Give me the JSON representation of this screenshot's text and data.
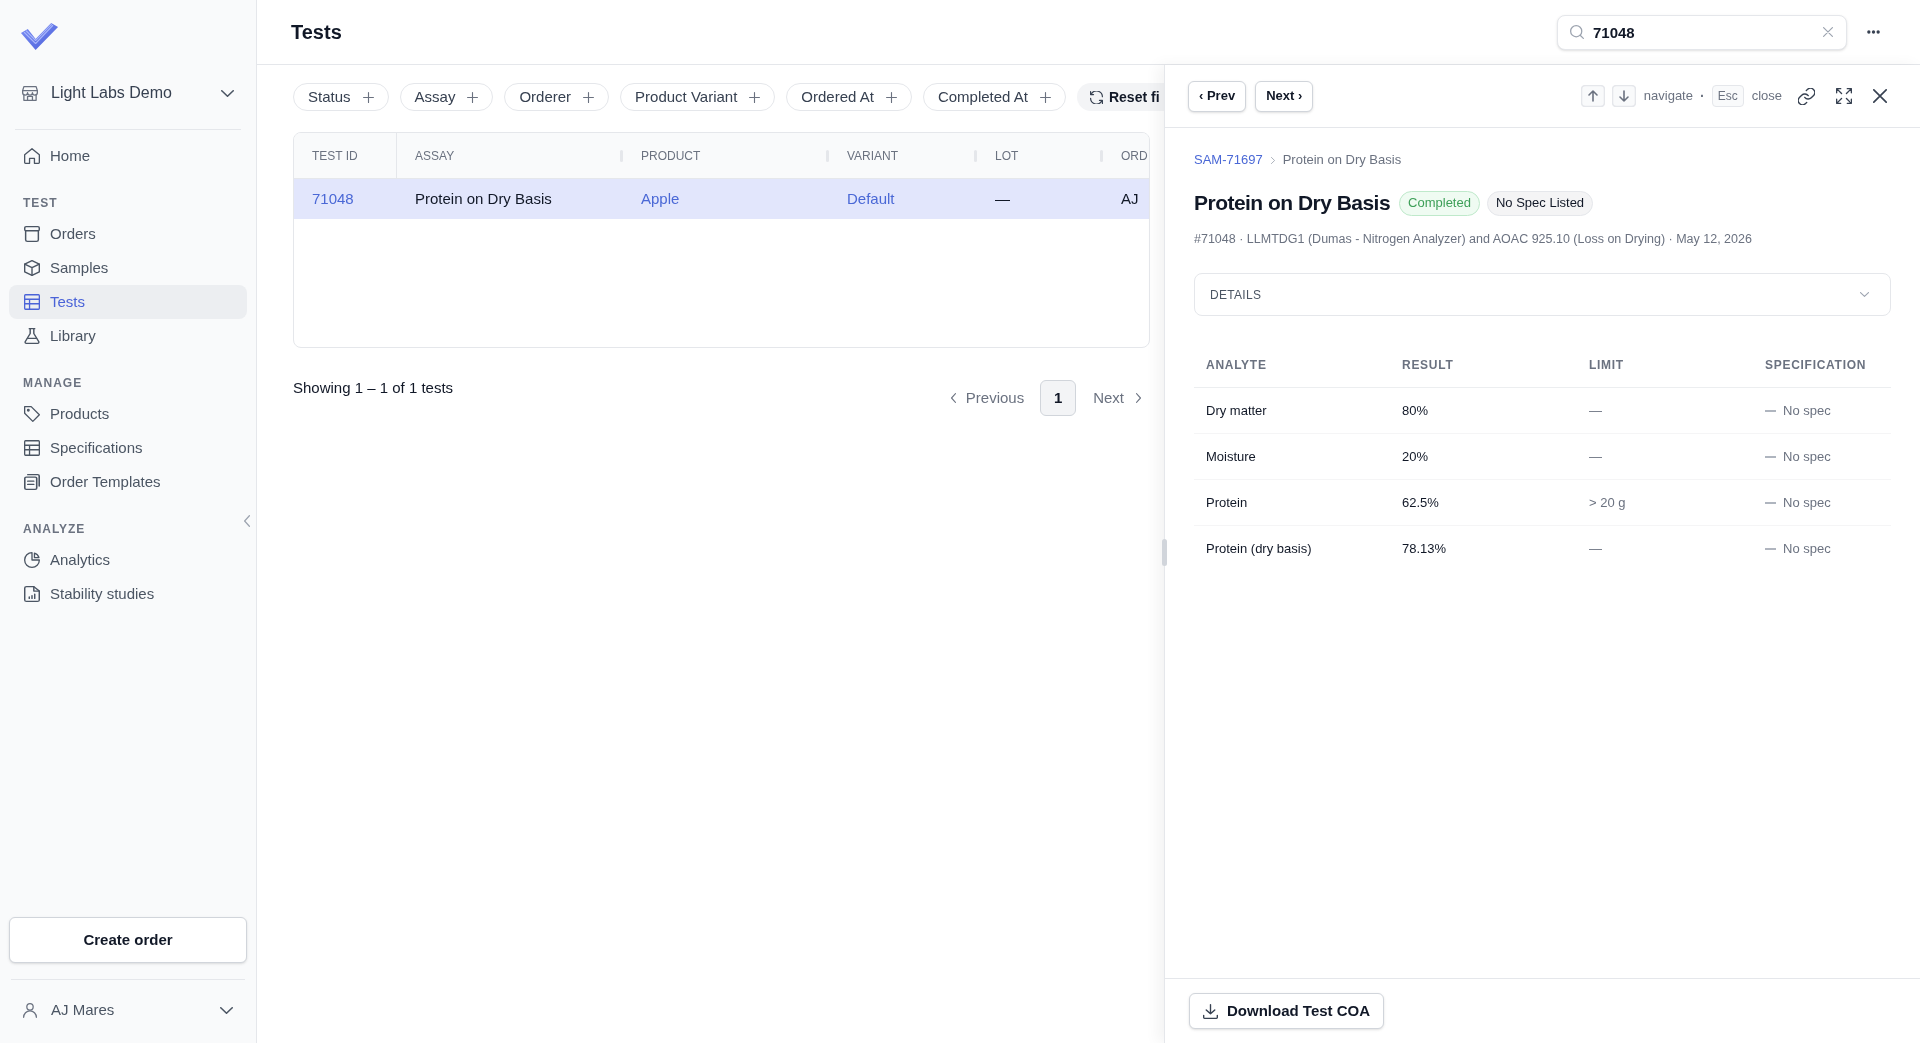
{
  "sidebar": {
    "org": {
      "name": "Light Labs Demo"
    },
    "sections": [
      {
        "items": [
          {
            "label": "Home",
            "selected": false
          }
        ]
      },
      {
        "heading": "TEST",
        "items": [
          {
            "label": "Orders",
            "selected": false
          },
          {
            "label": "Samples",
            "selected": false
          },
          {
            "label": "Tests",
            "selected": true
          },
          {
            "label": "Library",
            "selected": false
          }
        ]
      },
      {
        "heading": "MANAGE",
        "items": [
          {
            "label": "Products",
            "selected": false
          },
          {
            "label": "Specifications",
            "selected": false
          },
          {
            "label": "Order Templates",
            "selected": false
          }
        ]
      },
      {
        "heading": "ANALYZE",
        "items": [
          {
            "label": "Analytics",
            "selected": false
          },
          {
            "label": "Stability studies",
            "selected": false
          }
        ]
      }
    ],
    "create_button": "Create order",
    "user": {
      "name": "AJ Mares"
    }
  },
  "header": {
    "title": "Tests",
    "search": {
      "value": "71048"
    }
  },
  "filters": [
    {
      "label": "Status"
    },
    {
      "label": "Assay"
    },
    {
      "label": "Orderer"
    },
    {
      "label": "Product Variant"
    },
    {
      "label": "Ordered At"
    },
    {
      "label": "Completed At"
    }
  ],
  "reset_button": {
    "label": "Reset fi"
  },
  "table": {
    "columns": [
      "TEST ID",
      "ASSAY",
      "PRODUCT",
      "VARIANT",
      "LOT",
      "ORD"
    ],
    "rows": [
      {
        "selected": true,
        "cells": [
          {
            "text": "71048",
            "kind": "link"
          },
          {
            "text": "Protein on Dry Basis",
            "kind": "text"
          },
          {
            "text": "Apple",
            "kind": "link"
          },
          {
            "text": "Default",
            "kind": "link"
          },
          {
            "text": "—",
            "kind": "text"
          },
          {
            "text": "AJ",
            "kind": "text"
          }
        ]
      }
    ]
  },
  "pagination": {
    "summary": "Showing 1 – 1 of 1 tests",
    "previous": {
      "label": "Previous",
      "disabled": true
    },
    "pages": [
      {
        "label": "1",
        "selected": true
      }
    ],
    "next": {
      "label": "Next",
      "disabled": true
    }
  },
  "detail_panel": {
    "prev_button": "‹ Prev",
    "next_button": "Next ›",
    "shortcut_hints": {
      "navigate_label": "navigate",
      "separator": "·",
      "esc_key": "Esc",
      "close_label": "close"
    },
    "breadcrumb": [
      {
        "label": "SAM-71697",
        "kind": "link"
      },
      {
        "label": "Protein on Dry Basis",
        "kind": "current"
      }
    ],
    "title": "Protein on Dry Basis",
    "badges": [
      {
        "label": "Completed",
        "kind": "success"
      },
      {
        "label": "No Spec Listed",
        "kind": "neutral"
      }
    ],
    "meta": "#71048 · LLMTDG1 (Dumas - Nitrogen Analyzer) and AOAC 925.10 (Loss on Drying) · May 12, 2026",
    "details": {
      "label": "DETAILS",
      "expanded": false
    },
    "results_table": {
      "columns": [
        "ANALYTE",
        "RESULT",
        "LIMIT",
        "SPECIFICATION"
      ],
      "rows": [
        {
          "analyte": "Dry matter",
          "result": "80%",
          "limit": "—",
          "specification": "No spec"
        },
        {
          "analyte": "Moisture",
          "result": "20%",
          "limit": "—",
          "specification": "No spec"
        },
        {
          "analyte": "Protein",
          "result": "62.5%",
          "limit": "> 20 g",
          "specification": "No spec"
        },
        {
          "analyte": "Protein (dry basis)",
          "result": "78.13%",
          "limit": "—",
          "specification": "No spec"
        }
      ]
    },
    "download_button": "Download Test COA"
  }
}
